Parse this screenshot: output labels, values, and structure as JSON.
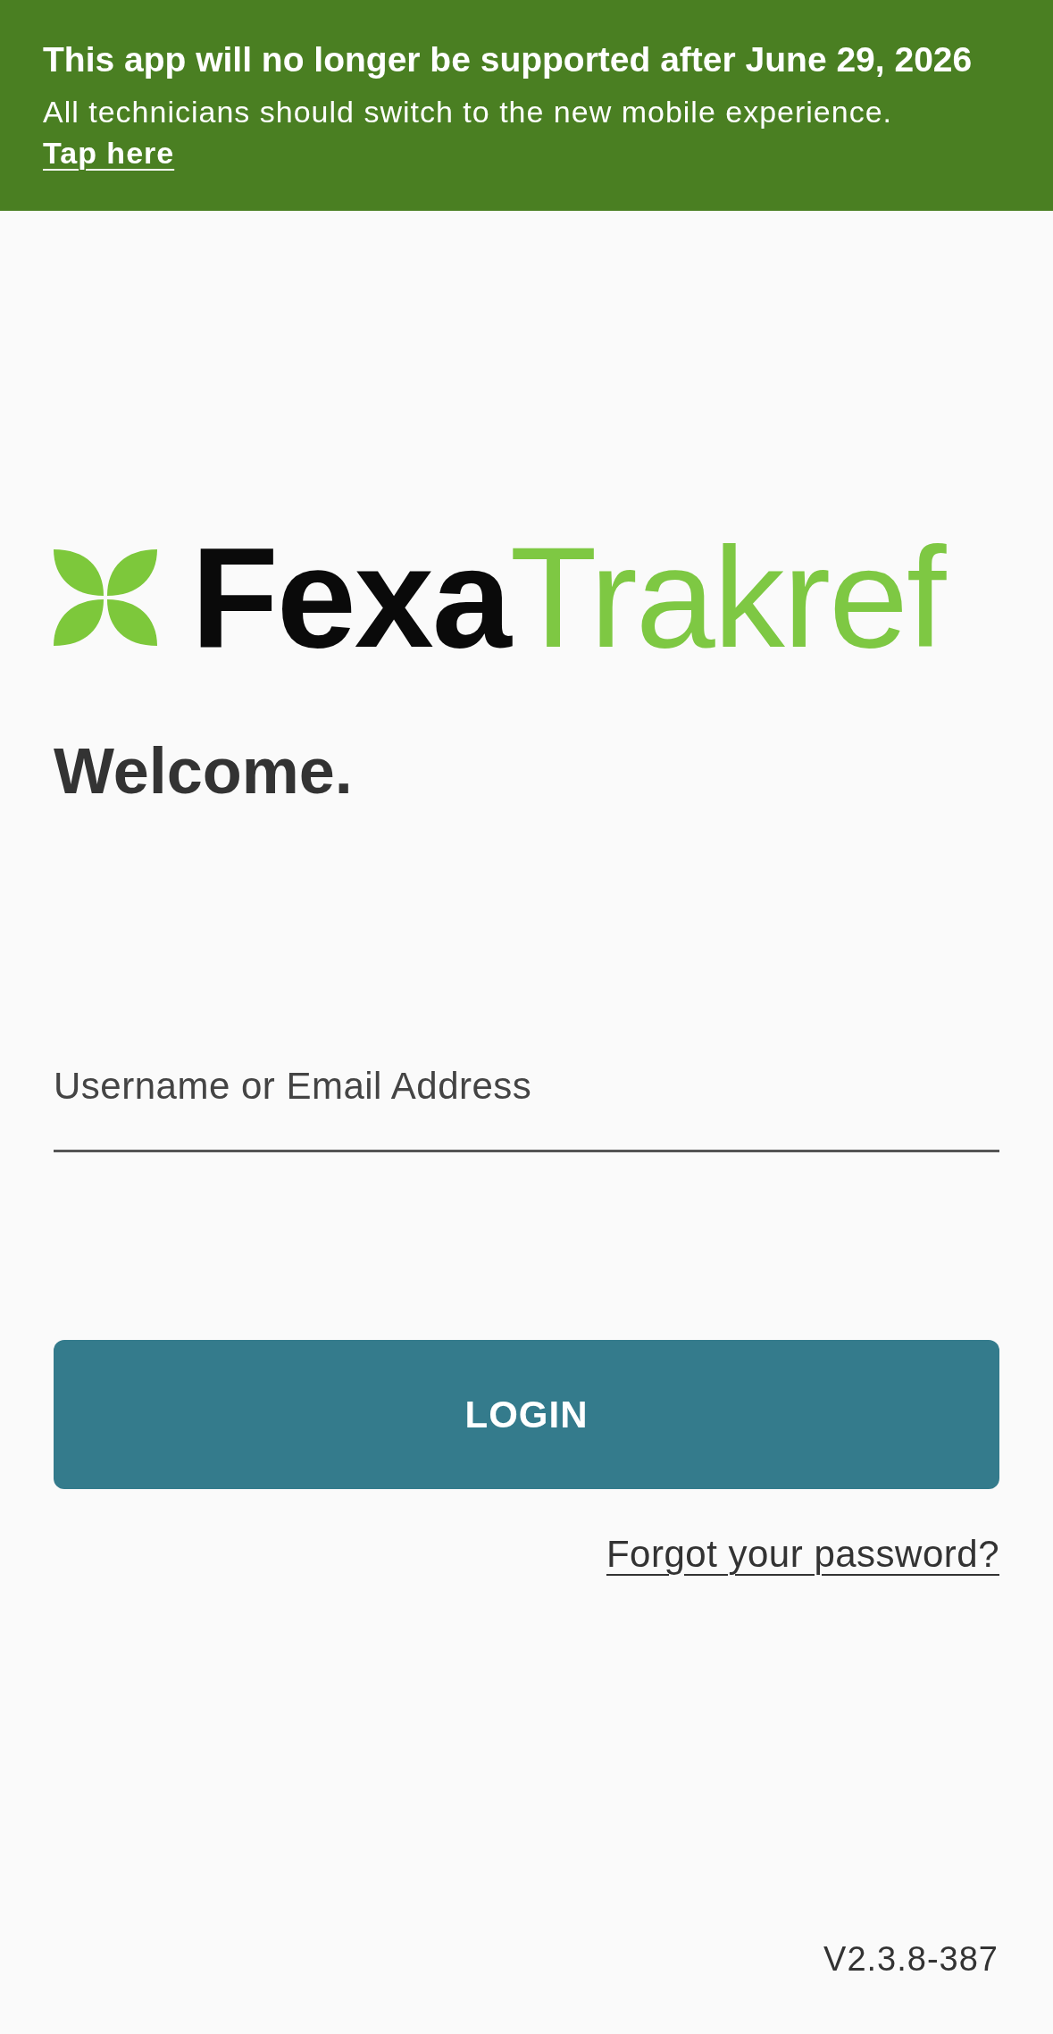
{
  "banner": {
    "title": "This app will no longer be supported after June 29, 2026",
    "message": "All technicians should switch to the new mobile experience.",
    "link": "Tap here"
  },
  "logo": {
    "text_bold": "Fexa",
    "text_light": "Trakref"
  },
  "heading": "Welcome.",
  "username_field": {
    "placeholder": "Username or Email Address"
  },
  "login_button": "LOGIN",
  "forgot_password_link": "Forgot your password?",
  "version": "V2.3.8-387"
}
